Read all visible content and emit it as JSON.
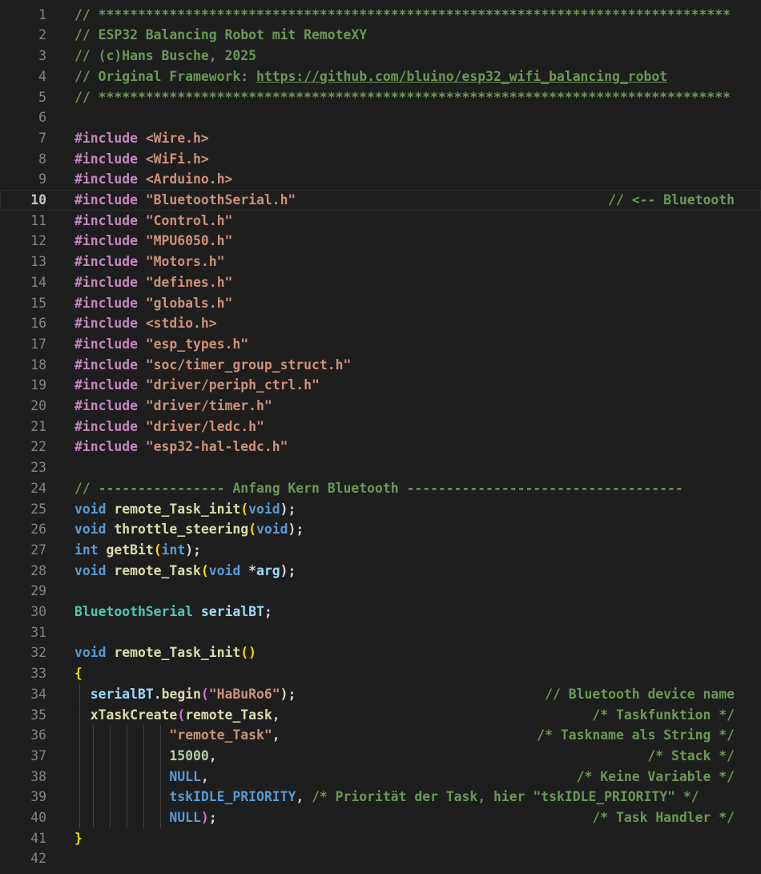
{
  "editor": {
    "top_fragment": "// ******",
    "lines": [
      {
        "num": "1",
        "code": [
          {
            "t": "// ********************************************************************************",
            "c": "c"
          }
        ]
      },
      {
        "num": "2",
        "code": [
          {
            "t": "// ESP32 Balancing Robot mit RemoteXY",
            "c": "c"
          }
        ]
      },
      {
        "num": "3",
        "code": [
          {
            "t": "// (c)Hans Busche, 2025",
            "c": "c"
          }
        ]
      },
      {
        "num": "4",
        "code": [
          {
            "t": "// Original Framework: ",
            "c": "c"
          },
          {
            "t": "https://github.com/bluino/esp32_wifi_balancing_robot",
            "c": "link"
          }
        ]
      },
      {
        "num": "5",
        "code": [
          {
            "t": "// ********************************************************************************",
            "c": "c"
          }
        ]
      },
      {
        "num": "6",
        "code": []
      },
      {
        "num": "7",
        "code": [
          {
            "t": "#include ",
            "c": "pp"
          },
          {
            "t": "<Wire.h>",
            "c": "s"
          }
        ]
      },
      {
        "num": "8",
        "code": [
          {
            "t": "#include ",
            "c": "pp"
          },
          {
            "t": "<WiFi.h>",
            "c": "s"
          }
        ]
      },
      {
        "num": "9",
        "code": [
          {
            "t": "#include ",
            "c": "pp"
          },
          {
            "t": "<Arduino.h>",
            "c": "s"
          }
        ]
      },
      {
        "num": "10",
        "current": true,
        "code": [
          {
            "t": "#include ",
            "c": "pp"
          },
          {
            "t": "\"BluetoothSerial.h\"",
            "c": "s"
          }
        ],
        "right": "// <-- Bluetooth"
      },
      {
        "num": "11",
        "code": [
          {
            "t": "#include ",
            "c": "pp"
          },
          {
            "t": "\"Control.h\"",
            "c": "s"
          }
        ]
      },
      {
        "num": "12",
        "code": [
          {
            "t": "#include ",
            "c": "pp"
          },
          {
            "t": "\"MPU6050.h\"",
            "c": "s"
          }
        ]
      },
      {
        "num": "13",
        "code": [
          {
            "t": "#include ",
            "c": "pp"
          },
          {
            "t": "\"Motors.h\"",
            "c": "s"
          }
        ]
      },
      {
        "num": "14",
        "code": [
          {
            "t": "#include ",
            "c": "pp"
          },
          {
            "t": "\"defines.h\"",
            "c": "s"
          }
        ]
      },
      {
        "num": "15",
        "code": [
          {
            "t": "#include ",
            "c": "pp"
          },
          {
            "t": "\"globals.h\"",
            "c": "s"
          }
        ]
      },
      {
        "num": "16",
        "code": [
          {
            "t": "#include ",
            "c": "pp"
          },
          {
            "t": "<stdio.h>",
            "c": "s"
          }
        ]
      },
      {
        "num": "17",
        "code": [
          {
            "t": "#include ",
            "c": "pp"
          },
          {
            "t": "\"esp_types.h\"",
            "c": "s"
          }
        ]
      },
      {
        "num": "18",
        "code": [
          {
            "t": "#include ",
            "c": "pp"
          },
          {
            "t": "\"soc/timer_group_struct.h\"",
            "c": "s"
          }
        ]
      },
      {
        "num": "19",
        "code": [
          {
            "t": "#include ",
            "c": "pp"
          },
          {
            "t": "\"driver/periph_ctrl.h\"",
            "c": "s"
          }
        ]
      },
      {
        "num": "20",
        "code": [
          {
            "t": "#include ",
            "c": "pp"
          },
          {
            "t": "\"driver/timer.h\"",
            "c": "s"
          }
        ]
      },
      {
        "num": "21",
        "code": [
          {
            "t": "#include ",
            "c": "pp"
          },
          {
            "t": "\"driver/ledc.h\"",
            "c": "s"
          }
        ]
      },
      {
        "num": "22",
        "code": [
          {
            "t": "#include ",
            "c": "pp"
          },
          {
            "t": "\"esp32-hal-ledc.h\"",
            "c": "s"
          }
        ]
      },
      {
        "num": "23",
        "code": []
      },
      {
        "num": "24",
        "code": [
          {
            "t": "// ---------------- Anfang Kern Bluetooth -----------------------------------",
            "c": "c"
          }
        ]
      },
      {
        "num": "25",
        "code": [
          {
            "t": "void ",
            "c": "k"
          },
          {
            "t": "remote_Task_init",
            "c": "f"
          },
          {
            "t": "(",
            "c": "br1"
          },
          {
            "t": "void",
            "c": "k"
          },
          {
            "t": ");",
            "c": "p"
          }
        ]
      },
      {
        "num": "26",
        "code": [
          {
            "t": "void ",
            "c": "k"
          },
          {
            "t": "throttle_steering",
            "c": "f"
          },
          {
            "t": "(",
            "c": "br1"
          },
          {
            "t": "void",
            "c": "k"
          },
          {
            "t": ");",
            "c": "p"
          }
        ]
      },
      {
        "num": "27",
        "code": [
          {
            "t": "int ",
            "c": "k"
          },
          {
            "t": "getBit",
            "c": "f"
          },
          {
            "t": "(",
            "c": "br1"
          },
          {
            "t": "int",
            "c": "k"
          },
          {
            "t": ");",
            "c": "p"
          }
        ]
      },
      {
        "num": "28",
        "code": [
          {
            "t": "void ",
            "c": "k"
          },
          {
            "t": "remote_Task",
            "c": "f"
          },
          {
            "t": "(",
            "c": "br1"
          },
          {
            "t": "void ",
            "c": "k"
          },
          {
            "t": "*",
            "c": "p"
          },
          {
            "t": "arg",
            "c": "v"
          },
          {
            "t": ");",
            "c": "p"
          }
        ]
      },
      {
        "num": "29",
        "code": []
      },
      {
        "num": "30",
        "code": [
          {
            "t": "BluetoothSerial ",
            "c": "t"
          },
          {
            "t": "serialBT",
            "c": "v"
          },
          {
            "t": ";",
            "c": "p"
          }
        ]
      },
      {
        "num": "31",
        "code": []
      },
      {
        "num": "32",
        "code": [
          {
            "t": "void ",
            "c": "k"
          },
          {
            "t": "remote_Task_init",
            "c": "f"
          },
          {
            "t": "()",
            "c": "br1"
          }
        ]
      },
      {
        "num": "33",
        "code": [
          {
            "t": "{",
            "c": "br1"
          }
        ]
      },
      {
        "num": "34",
        "guides": 1,
        "code": [
          {
            "t": "  ",
            "c": "p"
          },
          {
            "t": "serialBT",
            "c": "v"
          },
          {
            "t": ".",
            "c": "p"
          },
          {
            "t": "begin",
            "c": "f"
          },
          {
            "t": "(",
            "c": "br2"
          },
          {
            "t": "\"HaBuRo6\"",
            "c": "s"
          },
          {
            "t": ");",
            "c": "p"
          }
        ],
        "right": "// Bluetooth device name"
      },
      {
        "num": "35",
        "guides": 1,
        "code": [
          {
            "t": "  ",
            "c": "p"
          },
          {
            "t": "xTaskCreate",
            "c": "f"
          },
          {
            "t": "(",
            "c": "br2"
          },
          {
            "t": "remote_Task",
            "c": "f"
          },
          {
            "t": ",",
            "c": "p"
          }
        ],
        "right": "/* Taskfunktion */"
      },
      {
        "num": "36",
        "guides": 6,
        "code": [
          {
            "t": "            ",
            "c": "p"
          },
          {
            "t": "\"remote_Task\"",
            "c": "s"
          },
          {
            "t": ",",
            "c": "p"
          }
        ],
        "right": "/* Taskname als String */"
      },
      {
        "num": "37",
        "guides": 6,
        "code": [
          {
            "t": "            ",
            "c": "p"
          },
          {
            "t": "15000",
            "c": "n"
          },
          {
            "t": ",",
            "c": "p"
          }
        ],
        "right": "/* Stack */"
      },
      {
        "num": "38",
        "guides": 6,
        "code": [
          {
            "t": "            ",
            "c": "p"
          },
          {
            "t": "NULL",
            "c": "k"
          },
          {
            "t": ",",
            "c": "p"
          }
        ],
        "right": "/* Keine Variable */"
      },
      {
        "num": "39",
        "guides": 6,
        "code": [
          {
            "t": "            ",
            "c": "p"
          },
          {
            "t": "tskIDLE_PRIORITY",
            "c": "k"
          },
          {
            "t": ", ",
            "c": "p"
          },
          {
            "t": "/* Priorität der Task, hier \"tskIDLE_PRIORITY\" */",
            "c": "c"
          }
        ]
      },
      {
        "num": "40",
        "guides": 6,
        "code": [
          {
            "t": "            ",
            "c": "p"
          },
          {
            "t": "NULL",
            "c": "k"
          },
          {
            "t": ")",
            "c": "br2"
          },
          {
            "t": ";",
            "c": "p"
          }
        ],
        "right": "/* Task Handler */"
      },
      {
        "num": "41",
        "code": [
          {
            "t": "}",
            "c": "br1"
          }
        ]
      },
      {
        "num": "42",
        "code": []
      }
    ]
  }
}
